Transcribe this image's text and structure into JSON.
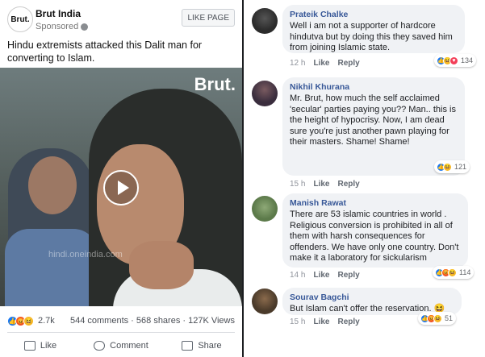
{
  "post": {
    "avatar_text": "Brut.",
    "page_name": "Brut India",
    "sponsored": "Sponsored",
    "like_page": "LIKE PAGE",
    "text": "Hindu extremists attacked this Dalit man for converting to Islam.",
    "video": {
      "logo": "Brut.",
      "watermark": "hindi.oneindia.com"
    },
    "reactions_count": "2.7k",
    "counts": "544 comments · 568 shares · 127K Views",
    "actions": {
      "like": "Like",
      "comment": "Comment",
      "share": "Share"
    }
  },
  "comments": [
    {
      "name": "Prateik Chalke",
      "text": "Well i am not a supporter of hardcore hindutva but by doing this they saved him from joining Islamic state.",
      "time": "12 h",
      "like": "Like",
      "reply": "Reply",
      "reaction_count": "134",
      "avatar_color": "#2b2b2b"
    },
    {
      "name": "Nikhil Khurana",
      "text": "Mr. Brut, how much the self acclaimed 'secular' parties paying you?? Man.. this is the height of hypocrisy. Now, I am dead sure you're just another pawn playing for their masters. Shame! Shame!",
      "time": "15 h",
      "like": "Like",
      "reply": "Reply",
      "reaction_count": "121",
      "avatar_color": "#3a2d3d"
    },
    {
      "name": "Manish Rawat",
      "text": "There are 53 islamic countries in world . Religious conversion is prohibited in all of them with harsh consequences for offenders. We have only one country. Don't make it a laboratory for sickularism",
      "time": "14 h",
      "like": "Like",
      "reply": "Reply",
      "reaction_count": "114",
      "avatar_color": "#5c7a4a"
    },
    {
      "name": "Sourav Bagchi",
      "text": "But Islam can't offer the reservation. 😆",
      "time": "15 h",
      "like": "Like",
      "reply": "Reply",
      "reaction_count": "51",
      "avatar_color": "#4a3a2a"
    }
  ],
  "colors": {
    "link_blue": "#385898",
    "like_blue": "#1877f2",
    "bubble": "#f0f2f5"
  }
}
